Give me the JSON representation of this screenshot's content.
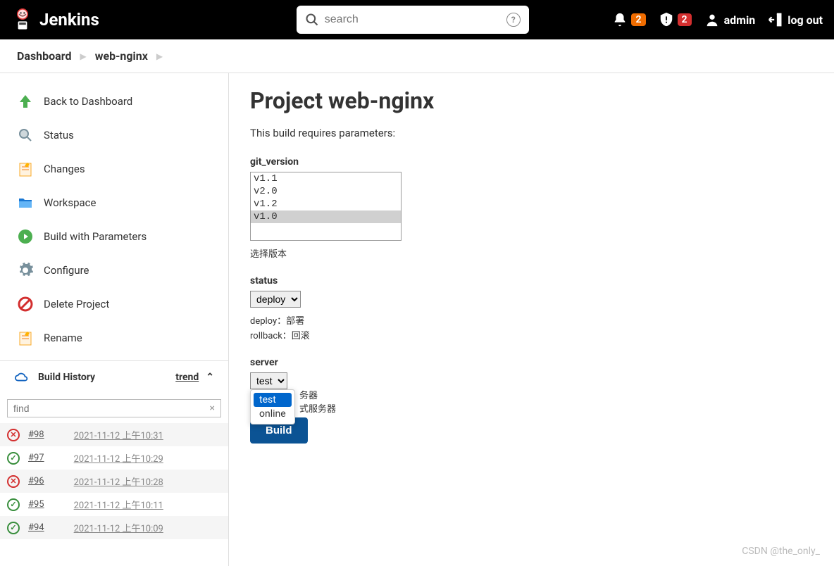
{
  "header": {
    "brand": "Jenkins",
    "search_placeholder": "search",
    "notif_badge": "2",
    "alert_badge": "2",
    "user": "admin",
    "logout": "log out"
  },
  "breadcrumb": {
    "items": [
      "Dashboard",
      "web-nginx"
    ]
  },
  "sidebar": {
    "items": [
      {
        "label": "Back to Dashboard",
        "icon": "up-arrow"
      },
      {
        "label": "Status",
        "icon": "magnify"
      },
      {
        "label": "Changes",
        "icon": "notepad"
      },
      {
        "label": "Workspace",
        "icon": "folder"
      },
      {
        "label": "Build with Parameters",
        "icon": "play-clock"
      },
      {
        "label": "Configure",
        "icon": "gear"
      },
      {
        "label": "Delete Project",
        "icon": "forbidden"
      },
      {
        "label": "Rename",
        "icon": "notepad"
      }
    ]
  },
  "build_history": {
    "title": "Build History",
    "trend": "trend",
    "find_placeholder": "find",
    "builds": [
      {
        "num": "#98",
        "time": "2021-11-12 上午10:31",
        "status": "fail"
      },
      {
        "num": "#97",
        "time": "2021-11-12 上午10:29",
        "status": "ok"
      },
      {
        "num": "#96",
        "time": "2021-11-12 上午10:28",
        "status": "fail"
      },
      {
        "num": "#95",
        "time": "2021-11-12 上午10:11",
        "status": "ok"
      },
      {
        "num": "#94",
        "time": "2021-11-12 上午10:09",
        "status": "ok"
      }
    ]
  },
  "main": {
    "title": "Project web-nginx",
    "subtitle": "This build requires parameters:",
    "params": {
      "git_version": {
        "label": "git_version",
        "options": [
          "v1.1",
          "v2.0",
          "v1.2",
          "v1.0"
        ],
        "selected": "v1.0",
        "helper": "选择版本"
      },
      "status": {
        "label": "status",
        "selected": "deploy",
        "helper1": "deploy：部署",
        "helper2": "rollback：回滚"
      },
      "server": {
        "label": "server",
        "selected": "test",
        "options": [
          "test",
          "online"
        ],
        "behind1": "务器",
        "behind2": "式服务器"
      }
    },
    "build_button": "Build"
  },
  "watermark": "CSDN @the_only_"
}
